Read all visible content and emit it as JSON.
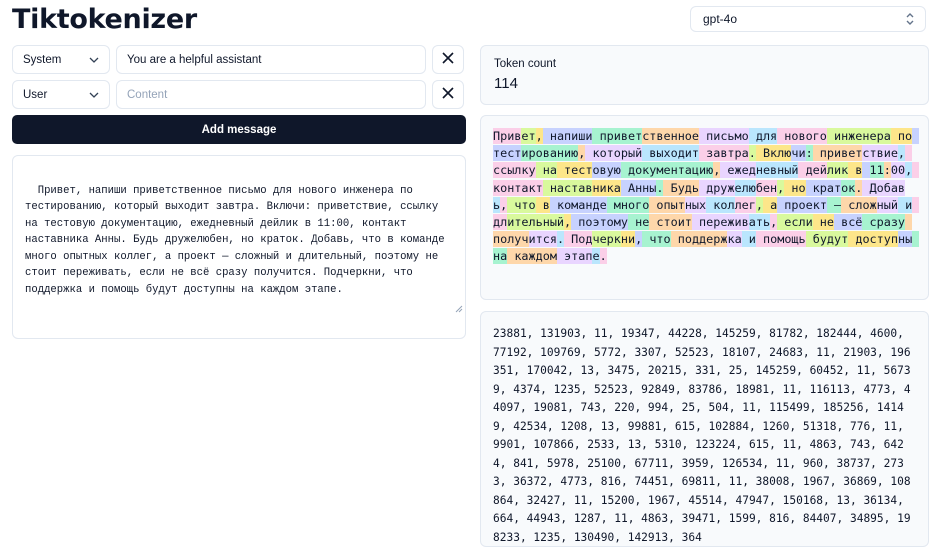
{
  "app": {
    "title": "Tiktokenizer"
  },
  "model": {
    "selected": "gpt-4o"
  },
  "messages": [
    {
      "role": "System",
      "content": "You are a helpful assistant",
      "placeholder": "Content"
    },
    {
      "role": "User",
      "content": "",
      "placeholder": "Content"
    }
  ],
  "add_message_label": "Add message",
  "editor": {
    "text": "Привет, напиши приветственное письмо для нового инженера по тестированию, который выходит завтра. Включи: приветствие, ссылку на тестовую документацию, ежедневный дейлик в 11:00, контакт наставника Анны. Будь дружелюбен, но краток. Добавь, что в команде много опытных коллег, а проект — сложный и длительный, поэтому не стоит переживать, если не всё сразу получится. Подчеркни, что поддержка и помощь будут доступны на каждом этапе."
  },
  "token_count": {
    "label": "Token count",
    "value": "114"
  },
  "colors": {
    "palette": [
      "#fbcfe8",
      "#d9f99d",
      "#fde68a",
      "#c7d2fe",
      "#a7f3d0",
      "#fed7aa",
      "#e9d5ff",
      "#bae6fd"
    ]
  },
  "tokens": [
    "Прив",
    "ет",
    ",",
    " напиши",
    " привет",
    "ственное",
    " письмо",
    " для",
    " нового",
    " инженера",
    " по",
    " тест",
    "ированию",
    ",",
    " который",
    " выходит",
    " завтра",
    ".",
    " Вклю",
    "чи",
    ":",
    " привет",
    "ствие",
    ",",
    " ссылку",
    " на",
    " тест",
    "овую",
    " документацию",
    ",",
    " ежед",
    "невный",
    " дей",
    "лик",
    " в",
    " ",
    "11",
    ":",
    "00",
    ",",
    " контакт",
    " настав",
    "ника",
    " Анны",
    ".",
    " Будь",
    " друж",
    "елю",
    "бен",
    ",",
    " но",
    " крат",
    "ок",
    ".",
    " Добав",
    "ь",
    ",",
    " что",
    " в",
    " команде",
    " много",
    " опыт",
    "ных",
    " кол",
    "лег",
    ",",
    " а",
    " проект",
    " —",
    " слож",
    "ный",
    " и",
    " дл",
    "ительный",
    ",",
    " поэтому",
    " не",
    " стоит",
    " пережив",
    "ать",
    ",",
    " если",
    " не",
    " всё",
    " сразу",
    " получ",
    "ится",
    ".",
    " Под",
    "черк",
    "ни",
    ",",
    " что",
    " поддерж",
    "ка",
    " и",
    " помощь",
    " будут",
    " доступ",
    "ны",
    " на",
    " каждом",
    " этап",
    "е",
    "."
  ],
  "token_ids": "23881, 131903, 11, 19347, 44228, 145259, 81782, 182444, 4600, 77192, 109769, 5772, 3307, 52523, 18107, 24683, 11, 21903, 196351, 170042, 13, 3475, 20215, 331, 25, 145259, 60452, 11, 56739, 4374, 1235, 52523, 92849, 83786, 18981, 11, 116113, 4773, 44097, 19081, 743, 220, 994, 25, 504, 11, 115499, 185256, 14149, 42534, 1208, 13, 99881, 615, 102884, 1260, 51318, 776, 11, 9901, 107866, 2533, 13, 5310, 123224, 615, 11, 4863, 743, 6424, 841, 5978, 25100, 67711, 3959, 126534, 11, 960, 38737, 2733, 36372, 4773, 816, 74451, 69811, 11, 38008, 1967, 36869, 108864, 32427, 11, 15200, 1967, 45514, 47947, 150168, 13, 36134, 664, 44943, 1287, 11, 4863, 39471, 1599, 816, 84407, 34895, 198233, 1235, 130490, 142913, 364"
}
